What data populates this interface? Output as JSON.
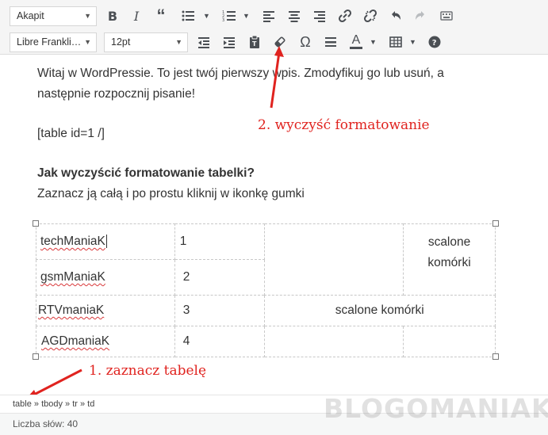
{
  "toolbar": {
    "paragraph_format": "Akapit",
    "font_family": "Libre Frankli…",
    "font_size": "12pt",
    "icons": [
      "bold-icon",
      "italic-icon",
      "blockquote-icon",
      "bullet-list-icon",
      "numbered-list-icon",
      "align-left-icon",
      "align-center-icon",
      "align-right-icon",
      "link-icon",
      "unlink-icon",
      "undo-icon",
      "redo-icon",
      "keyboard-icon",
      "outdent-icon",
      "indent-icon",
      "paste-text-icon",
      "clear-formatting-icon",
      "special-character-icon",
      "horizontal-line-icon",
      "text-color-icon",
      "table-icon",
      "help-icon"
    ]
  },
  "content": {
    "intro_line1": "Witaj w WordPressie. To jest twój pierwszy wpis. Zmodyfikuj go lub usuń, a",
    "intro_line2": "następnie rozpocznij pisanie!",
    "shortcode": "[table id=1 /]",
    "heading": "Jak wyczyścić formatowanie tabelki?",
    "instruction": "Zaznacz ją całą i po prostu kliknij w ikonkę gumki"
  },
  "table": {
    "rows": [
      {
        "name": "techManiaK",
        "number": "1"
      },
      {
        "name": "gsmManiaK",
        "number": "2"
      },
      {
        "name": "RTVmaniaK",
        "number": "3"
      },
      {
        "name": "AGDmaniaK",
        "number": "4"
      }
    ],
    "merged_cell_top": "scalone komórki",
    "merged_cell_row3": "scalone komórki"
  },
  "annotations": {
    "step1": "1. zaznacz tabelę",
    "step2": "2. wyczyść formatowanie",
    "color": "#e0231f"
  },
  "status": {
    "path": "table » tbody » tr » td",
    "word_count": "Liczba słów: 40"
  },
  "watermark": "BLOGOMANIAK"
}
